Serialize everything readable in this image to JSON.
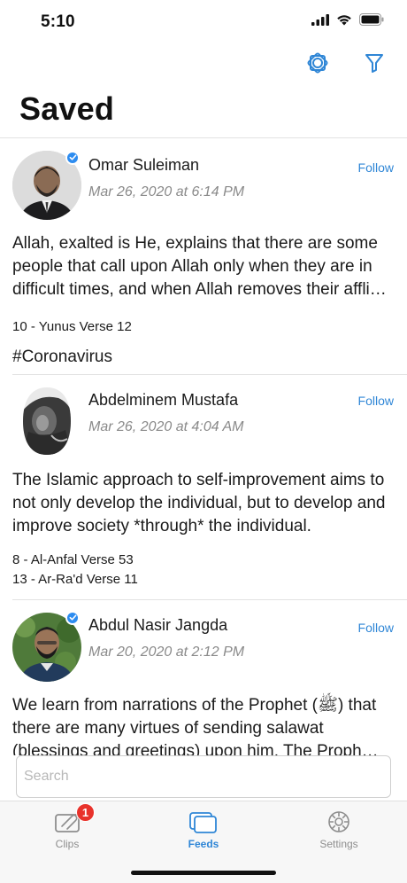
{
  "status_bar": {
    "time": "5:10"
  },
  "nav": {
    "sync_icon": "sync-badge-icon",
    "filter_icon": "funnel-icon"
  },
  "page": {
    "title": "Saved"
  },
  "posts": [
    {
      "author": "Omar Suleiman",
      "verified": true,
      "date": "Mar 26, 2020 at 6:14 PM",
      "follow_label": "Follow",
      "body": "Allah, exalted is He, explains that there are some people that call upon Allah only when they are in difficult times, and when Allah removes their affli…",
      "references": [
        "10 - Yunus  Verse 12"
      ],
      "tag": "#Coronavirus"
    },
    {
      "author": "Abdelminem Mustafa",
      "verified": false,
      "date": "Mar 26, 2020 at 4:04 AM",
      "follow_label": "Follow",
      "body": "The Islamic approach to self-improvement aims to not only develop the individual, but to develop and improve society *through* the individual.",
      "references": [
        "8 - Al-Anfal  Verse 53",
        "13 - Ar-Ra'd  Verse 11"
      ]
    },
    {
      "author": "Abdul Nasir Jangda",
      "verified": true,
      "date": "Mar 20, 2020 at 2:12 PM",
      "follow_label": "Follow",
      "body": "We learn from narrations of the Prophet (ﷺ) that there are many virtues of sending salawat (blessings and greetings) upon him. The Proph…"
    }
  ],
  "search": {
    "placeholder": "Search",
    "value": ""
  },
  "tab_bar": {
    "tabs": [
      {
        "label": "Clips",
        "icon": "clips-icon",
        "badge": "1",
        "active": false
      },
      {
        "label": "Feeds",
        "icon": "feeds-icon",
        "active": true
      },
      {
        "label": "Settings",
        "icon": "gear-icon",
        "active": false
      }
    ]
  },
  "colors": {
    "accent": "#2f86d6",
    "badge": "#e8322b",
    "verified": "#2d8cf0"
  }
}
